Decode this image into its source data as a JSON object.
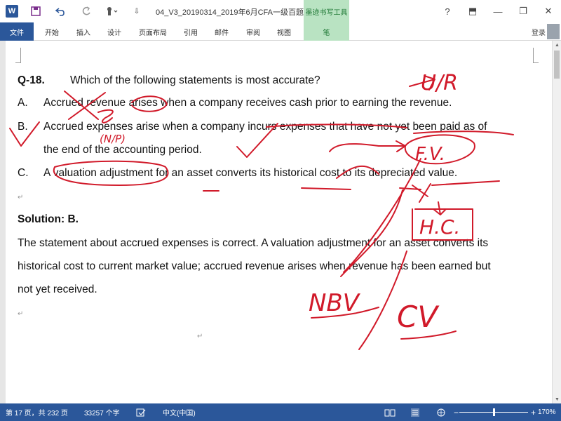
{
  "titlebar": {
    "doc_title": "04_V3_20190314_2019年6月CFA一级百题预...",
    "ink_tools_tab": "墨迹书写工具",
    "help": "?",
    "restore_ribbon": "⬒",
    "minimize": "—",
    "restore": "❐",
    "close": "✕"
  },
  "ribbon": {
    "tabs": [
      "文件",
      "开始",
      "插入",
      "设计",
      "页面布局",
      "引用",
      "邮件",
      "审阅",
      "视图",
      "笔"
    ],
    "login": "登录"
  },
  "document": {
    "question_num": "Q-18.",
    "question": "Which of the following statements is most accurate?",
    "opt_a_label": "A.",
    "opt_a": "Accrued revenue arises when a company receives cash prior to earning the revenue.",
    "opt_b_label": "B.",
    "opt_b_1": "Accrued expenses arise when a company incurs expenses that have not yet been paid as of",
    "opt_b_2": "the end of the accounting period.",
    "opt_c_label": "C.",
    "opt_c": "A valuation adjustment for an asset converts its historical cost to its depreciated value.",
    "solution": "Solution: B.",
    "explain_1": "The statement about accrued expenses is correct. A valuation adjustment for an asset converts its",
    "explain_2": "historical cost to current market value; accrued revenue arises when revenue has been earned but",
    "explain_3": "not yet received.",
    "para_mark": "↵"
  },
  "status": {
    "page": "第 17 页，共 232 页",
    "words": "33257 个字",
    "language": "中文(中国)",
    "zoom": "170%",
    "zoom_minus": "−",
    "zoom_plus": "+"
  },
  "ink": {
    "handwritten_ur": "U/R",
    "handwritten_np": "(N/P)",
    "handwritten_fv": "F.V.",
    "handwritten_hc": "H.C.",
    "handwritten_nbv": "NBV",
    "handwritten_cv": "CV",
    "color": "#d11a2a"
  },
  "colors": {
    "word_blue": "#2b579a",
    "ink_tab_green": "#b9e3c2"
  }
}
